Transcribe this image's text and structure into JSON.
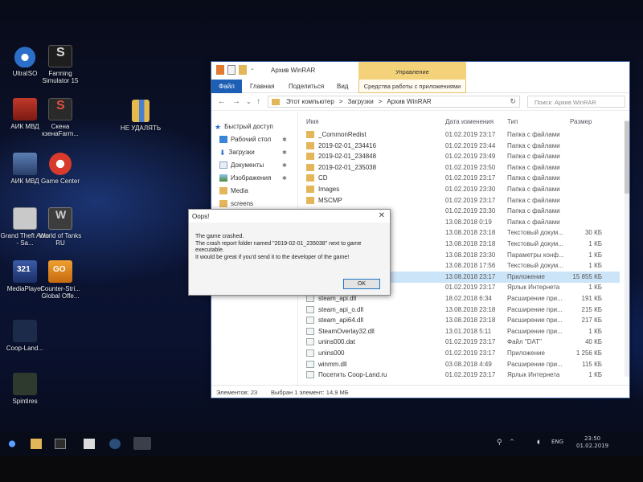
{
  "desktop": {
    "icons": [
      {
        "label": "UltraISO"
      },
      {
        "label": "Farming Simulator 15"
      },
      {
        "label": "АИК МВД"
      },
      {
        "label": "Скена кзенаFarm..."
      },
      {
        "label": "НЕ УДАЛЯТЬ"
      },
      {
        "label": "АИК МВД"
      },
      {
        "label": "Game Center"
      },
      {
        "label": "Grand Theft Auto - Sa..."
      },
      {
        "label": "World of Tanks RU"
      },
      {
        "label": "MediaPlayer"
      },
      {
        "label": "Counter-Stri... Global Offe..."
      },
      {
        "label": "Coop-Land..."
      },
      {
        "label": "Spintires"
      }
    ]
  },
  "explorer": {
    "title": "Архив WinRAR",
    "context_tab": "Управление",
    "tabs": {
      "file": "Файл",
      "home": "Главная",
      "share": "Поделиться",
      "view": "Вид",
      "app_tools": "Средства работы с приложениями"
    },
    "nav": {
      "back": "←",
      "forward": "→",
      "dropdown": "⌄",
      "up": "↑",
      "refresh": "↻"
    },
    "address": {
      "segments": [
        "Этот компьютер",
        ">",
        "Загрузки",
        ">",
        "Архив WinRAR"
      ]
    },
    "search_placeholder": "Поиск: Архив WinRAR",
    "sidebar": [
      {
        "label": "Быстрый доступ"
      },
      {
        "label": "Рабочий стол",
        "pin": "✱"
      },
      {
        "label": "Загрузки",
        "pin": "✱"
      },
      {
        "label": "Документы",
        "pin": "✱"
      },
      {
        "label": "Изображения",
        "pin": "✱"
      },
      {
        "label": "Media"
      },
      {
        "label": "screens"
      }
    ],
    "columns": {
      "name": "Имя",
      "date": "Дата изменения",
      "type": "Тип",
      "size": "Размер"
    },
    "rows": [
      {
        "name": "_CommonRedist",
        "date": "01.02.2019 23:17",
        "type": "Папка с файлами",
        "size": ""
      },
      {
        "name": "2019-02-01_234416",
        "date": "01.02.2019 23:44",
        "type": "Папка с файлами",
        "size": ""
      },
      {
        "name": "2019-02-01_234848",
        "date": "01.02.2019 23:49",
        "type": "Папка с файлами",
        "size": ""
      },
      {
        "name": "2019-02-01_235038",
        "date": "01.02.2019 23:50",
        "type": "Папка с файлами",
        "size": ""
      },
      {
        "name": "CD",
        "date": "01.02.2019 23:17",
        "type": "Папка с файлами",
        "size": ""
      },
      {
        "name": "Images",
        "date": "01.02.2019 23:30",
        "type": "Папка с файлами",
        "size": ""
      },
      {
        "name": "MSCMP",
        "date": "01.02.2019 23:17",
        "type": "Папка с файлами",
        "size": ""
      },
      {
        "name": "",
        "date": "01.02.2019 23:30",
        "type": "Папка с файлами",
        "size": ""
      },
      {
        "name": "",
        "date": "13.08.2018 0:19",
        "type": "Папка с файлами",
        "size": ""
      },
      {
        "name": "",
        "date": "13.08.2018 23:18",
        "type": "Текстовый докум...",
        "size": "30 КБ"
      },
      {
        "name": "",
        "date": "13.08.2018 23:18",
        "type": "Текстовый докум...",
        "size": "1 КБ"
      },
      {
        "name": "",
        "date": "13.08.2018 23:30",
        "type": "Параметры конф...",
        "size": "1 КБ"
      },
      {
        "name": "",
        "date": "13.08.2018 17:56",
        "type": "Текстовый докум...",
        "size": "1 КБ"
      },
      {
        "name": "",
        "date": "13.08.2018 23:17",
        "type": "Приложение",
        "size": "15 855 КБ"
      },
      {
        "name": "",
        "date": "01.02.2019 23:17",
        "type": "Ярлык Интернета",
        "size": "1 КБ"
      },
      {
        "name": "steam_api.dll",
        "date": "18.02.2018 6:34",
        "type": "Расширение при...",
        "size": "191 КБ"
      },
      {
        "name": "steam_api_o.dll",
        "date": "13.08.2018 23:18",
        "type": "Расширение при...",
        "size": "215 КБ"
      },
      {
        "name": "steam_api64.dll",
        "date": "13.08.2018 23:18",
        "type": "Расширение при...",
        "size": "217 КБ"
      },
      {
        "name": "SteamOverlay32.dll",
        "date": "13.01.2018 5:11",
        "type": "Расширение при...",
        "size": "1 КБ"
      },
      {
        "name": "unins000.dat",
        "date": "01.02.2019 23:17",
        "type": "Файл \"DAT\"",
        "size": "40 КБ"
      },
      {
        "name": "unins000",
        "date": "01.02.2019 23:17",
        "type": "Приложение",
        "size": "1 256 КБ"
      },
      {
        "name": "winmm.dll",
        "date": "03.08.2018 4:49",
        "type": "Расширение при...",
        "size": "115 КБ"
      },
      {
        "name": "Посетить Coop-Land.ru",
        "date": "01.02.2019 23:17",
        "type": "Ярлык Интернета",
        "size": "1 КБ"
      }
    ],
    "status": {
      "count": "Элементов: 23",
      "selected": "Выбран 1 элемент: 14,9 МБ"
    }
  },
  "dialog": {
    "title": "Oops!",
    "close": "✕",
    "lines": [
      "The game crashed.",
      "The crash report folder named \"2019-02-01_235038\" next to game",
      "executable.",
      "It would be great if you'd send it to the developer of the game!"
    ],
    "ok": "OK"
  },
  "taskbar": {
    "tray": {
      "lang": "ENG",
      "time": "23:50",
      "date": "01.02.2019"
    }
  },
  "colors": {
    "folder": "#e4b65a",
    "accent": "#1d5fb5",
    "context_tab": "#f3d27a",
    "selection": "#cce4f7"
  }
}
